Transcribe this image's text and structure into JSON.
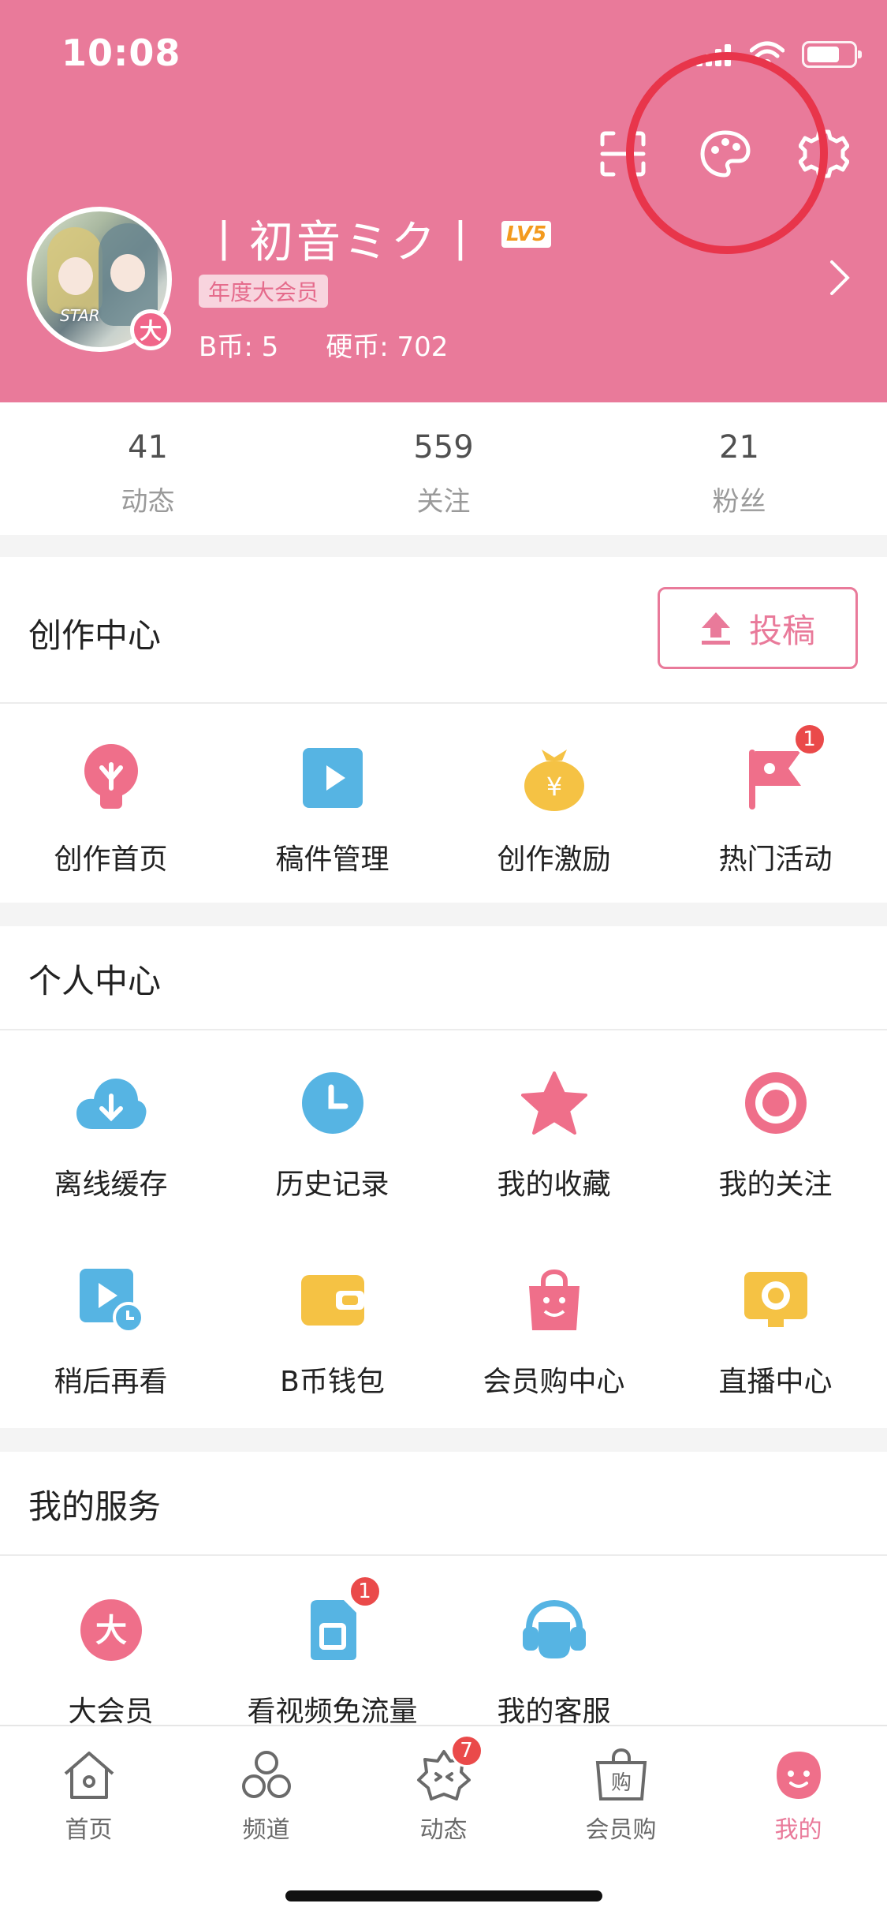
{
  "status_bar": {
    "time": "10:08"
  },
  "profile": {
    "username": "丨初音ミク丨",
    "level": "LV5",
    "vip_tag": "年度大会员",
    "vip_badge": "大",
    "avatar_text": "STAR",
    "b_coin_label": "B币:",
    "b_coin_value": "5",
    "coin_label": "硬币:",
    "coin_value": "702"
  },
  "stats": [
    {
      "value": "41",
      "label": "动态"
    },
    {
      "value": "559",
      "label": "关注"
    },
    {
      "value": "21",
      "label": "粉丝"
    }
  ],
  "creation": {
    "title": "创作中心",
    "upload_label": "投稿",
    "items": [
      {
        "label": "创作首页",
        "icon": "lightbulb-icon",
        "color": "#ef6f8a"
      },
      {
        "label": "稿件管理",
        "icon": "play-square-icon",
        "color": "#56b4e3"
      },
      {
        "label": "创作激励",
        "icon": "money-bag-icon",
        "color": "#f5c244"
      },
      {
        "label": "热门活动",
        "icon": "flag-icon",
        "color": "#ef6f8a",
        "badge": "1"
      }
    ]
  },
  "personal": {
    "title": "个人中心",
    "items": [
      {
        "label": "离线缓存",
        "icon": "cloud-download-icon",
        "color": "#56b4e3"
      },
      {
        "label": "历史记录",
        "icon": "clock-icon",
        "color": "#56b4e3"
      },
      {
        "label": "我的收藏",
        "icon": "star-icon",
        "color": "#ef6f8a"
      },
      {
        "label": "我的关注",
        "icon": "target-icon",
        "color": "#ef6f8a"
      },
      {
        "label": "稍后再看",
        "icon": "watch-later-icon",
        "color": "#56b4e3"
      },
      {
        "label": "B币钱包",
        "icon": "wallet-icon",
        "color": "#f5c244"
      },
      {
        "label": "会员购中心",
        "icon": "shopping-bag-icon",
        "color": "#ef6f8a"
      },
      {
        "label": "直播中心",
        "icon": "live-tv-icon",
        "color": "#f5c244"
      }
    ]
  },
  "services": {
    "title": "我的服务",
    "items": [
      {
        "label": "大会员",
        "icon": "vip-icon",
        "color": "#ef6f8a"
      },
      {
        "label": "看视频免流量",
        "icon": "sim-card-icon",
        "color": "#56b4e3",
        "badge": "1"
      },
      {
        "label": "我的客服",
        "icon": "headset-icon",
        "color": "#56b4e3"
      }
    ]
  },
  "tabbar": [
    {
      "label": "首页",
      "icon": "home-icon"
    },
    {
      "label": "频道",
      "icon": "channel-icon"
    },
    {
      "label": "动态",
      "icon": "dynamic-icon",
      "badge": "7"
    },
    {
      "label": "会员购",
      "icon": "shop-icon"
    },
    {
      "label": "我的",
      "icon": "mine-icon",
      "active": true
    }
  ],
  "colors": {
    "header": "#e97a9a",
    "accent": "#e97a9a",
    "highlight": "#e8354b"
  }
}
